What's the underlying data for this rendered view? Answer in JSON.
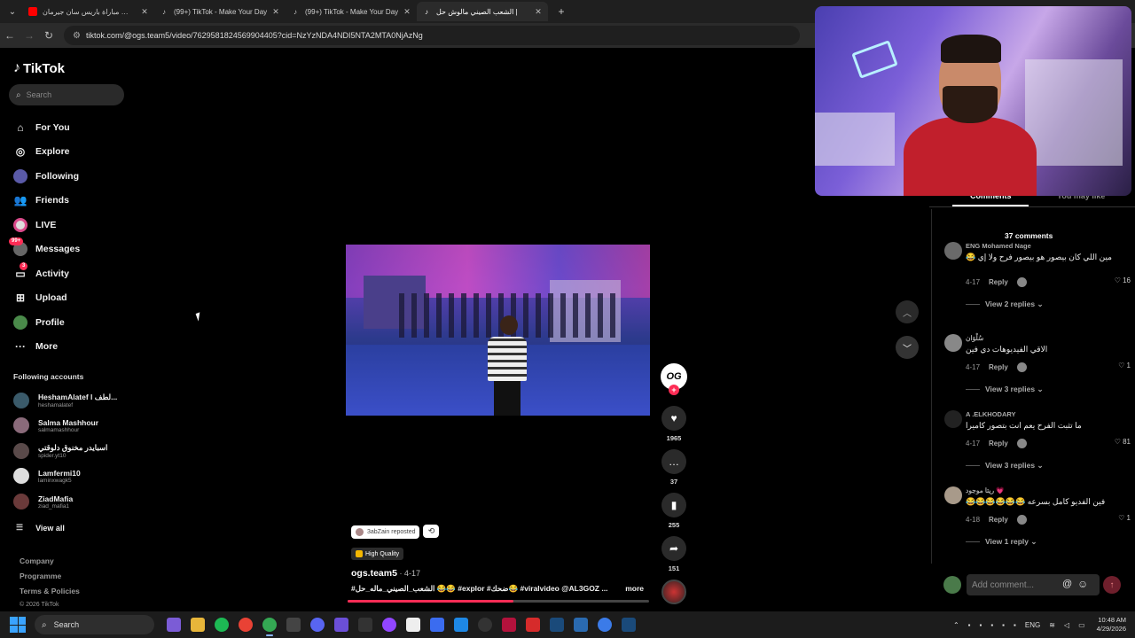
{
  "browser": {
    "tabs": [
      {
        "title": "ملخص مباراة باريس سان جيرمان",
        "favicon_color": "#ff0000",
        "active": false
      },
      {
        "title": "(99+) TikTok - Make Your Day",
        "favicon_color": "#000000",
        "active": false
      },
      {
        "title": "(99+) TikTok - Make Your Day",
        "favicon_color": "#000000",
        "active": false
      },
      {
        "title": "الشعب الصيني مالوش حل |",
        "favicon_color": "#000000",
        "active": true
      }
    ],
    "url": "tiktok.com/@ogs.team5/video/7629581824569904405?cid=NzYzNDA4NDI5NTA2MTA0NjAzNg"
  },
  "sidebar": {
    "logo": "TikTok",
    "search_placeholder": "Search",
    "nav": [
      {
        "label": "For You",
        "icon": "home-icon"
      },
      {
        "label": "Explore",
        "icon": "compass-icon"
      },
      {
        "label": "Following",
        "icon": "avatar-icon"
      },
      {
        "label": "Friends",
        "icon": "friends-icon"
      },
      {
        "label": "LIVE",
        "icon": "live-icon"
      },
      {
        "label": "Messages",
        "icon": "messages-icon",
        "badge": "99+"
      },
      {
        "label": "Activity",
        "icon": "activity-icon",
        "badge": "3"
      },
      {
        "label": "Upload",
        "icon": "upload-icon"
      },
      {
        "label": "Profile",
        "icon": "profile-icon"
      },
      {
        "label": "More",
        "icon": "more-icon"
      }
    ],
    "following_title": "Following accounts",
    "accounts": [
      {
        "name": "HeshamAlatef l لطف...",
        "handle": "heshamalatef"
      },
      {
        "name": "Salma Mashhour",
        "handle": "salmamashhour"
      },
      {
        "name": "اسبايدر مخنوق دلوقتي",
        "handle": "spider.yt10"
      },
      {
        "name": "Lamfermi10",
        "handle": "laminxwagk5"
      },
      {
        "name": "ZiadMafia",
        "handle": "ziad_mafia1"
      }
    ],
    "view_all": "View all",
    "footer": [
      "Company",
      "Programme",
      "Terms & Policies"
    ],
    "copyright": "© 2026 TikTok"
  },
  "video": {
    "creator_logo": "OG",
    "likes": "1965",
    "comments": "37",
    "saves": "255",
    "shares": "151",
    "reposted_by": "3abZain reposted",
    "quality": "High Quality",
    "author": "ogs.team5",
    "date": " · 4-17",
    "caption": "#الشعب_الصيني_ماله_حل 😂😂 #explor #ضحك😂 #viralvideo @AL3GOZ ...",
    "more": "more",
    "progress": 0.55
  },
  "comments_panel": {
    "tab_comments": "Comments",
    "tab_you_may_like": "You may like",
    "count_label": "37 comments",
    "comments": [
      {
        "user": "ENG Mohamed Nage",
        "text": "مين اللي كان بيصور هو بيصور فرح ولا إي 😂",
        "date": "4-17",
        "reply": "Reply",
        "likes": "16",
        "replies": "View 2 replies"
      },
      {
        "user": "سُلْوَان",
        "text": "الاقي الفيديوهات دي فين",
        "date": "4-17",
        "reply": "Reply",
        "likes": "1",
        "replies": "View 3 replies"
      },
      {
        "user": "A .ELKHODARY",
        "text": "ما تثبت الفرح يعم انت بتصور كاميرا",
        "date": "4-17",
        "reply": "Reply",
        "likes": "81",
        "replies": "View 3 replies"
      },
      {
        "user": "ريتا موجود 💗",
        "text": "فين الفديو كامل بسرعه 😂😂😂😂😂😂",
        "date": "4-18",
        "reply": "Reply",
        "likes": "1",
        "replies": "View 1 reply"
      }
    ],
    "add_comment_placeholder": "Add comment..."
  },
  "taskbar": {
    "search": "Search",
    "language": "ENG",
    "time": "10:48 AM",
    "date": "4/29/2026"
  },
  "colors": {
    "accent": "#fe2c55",
    "background": "#000000"
  }
}
